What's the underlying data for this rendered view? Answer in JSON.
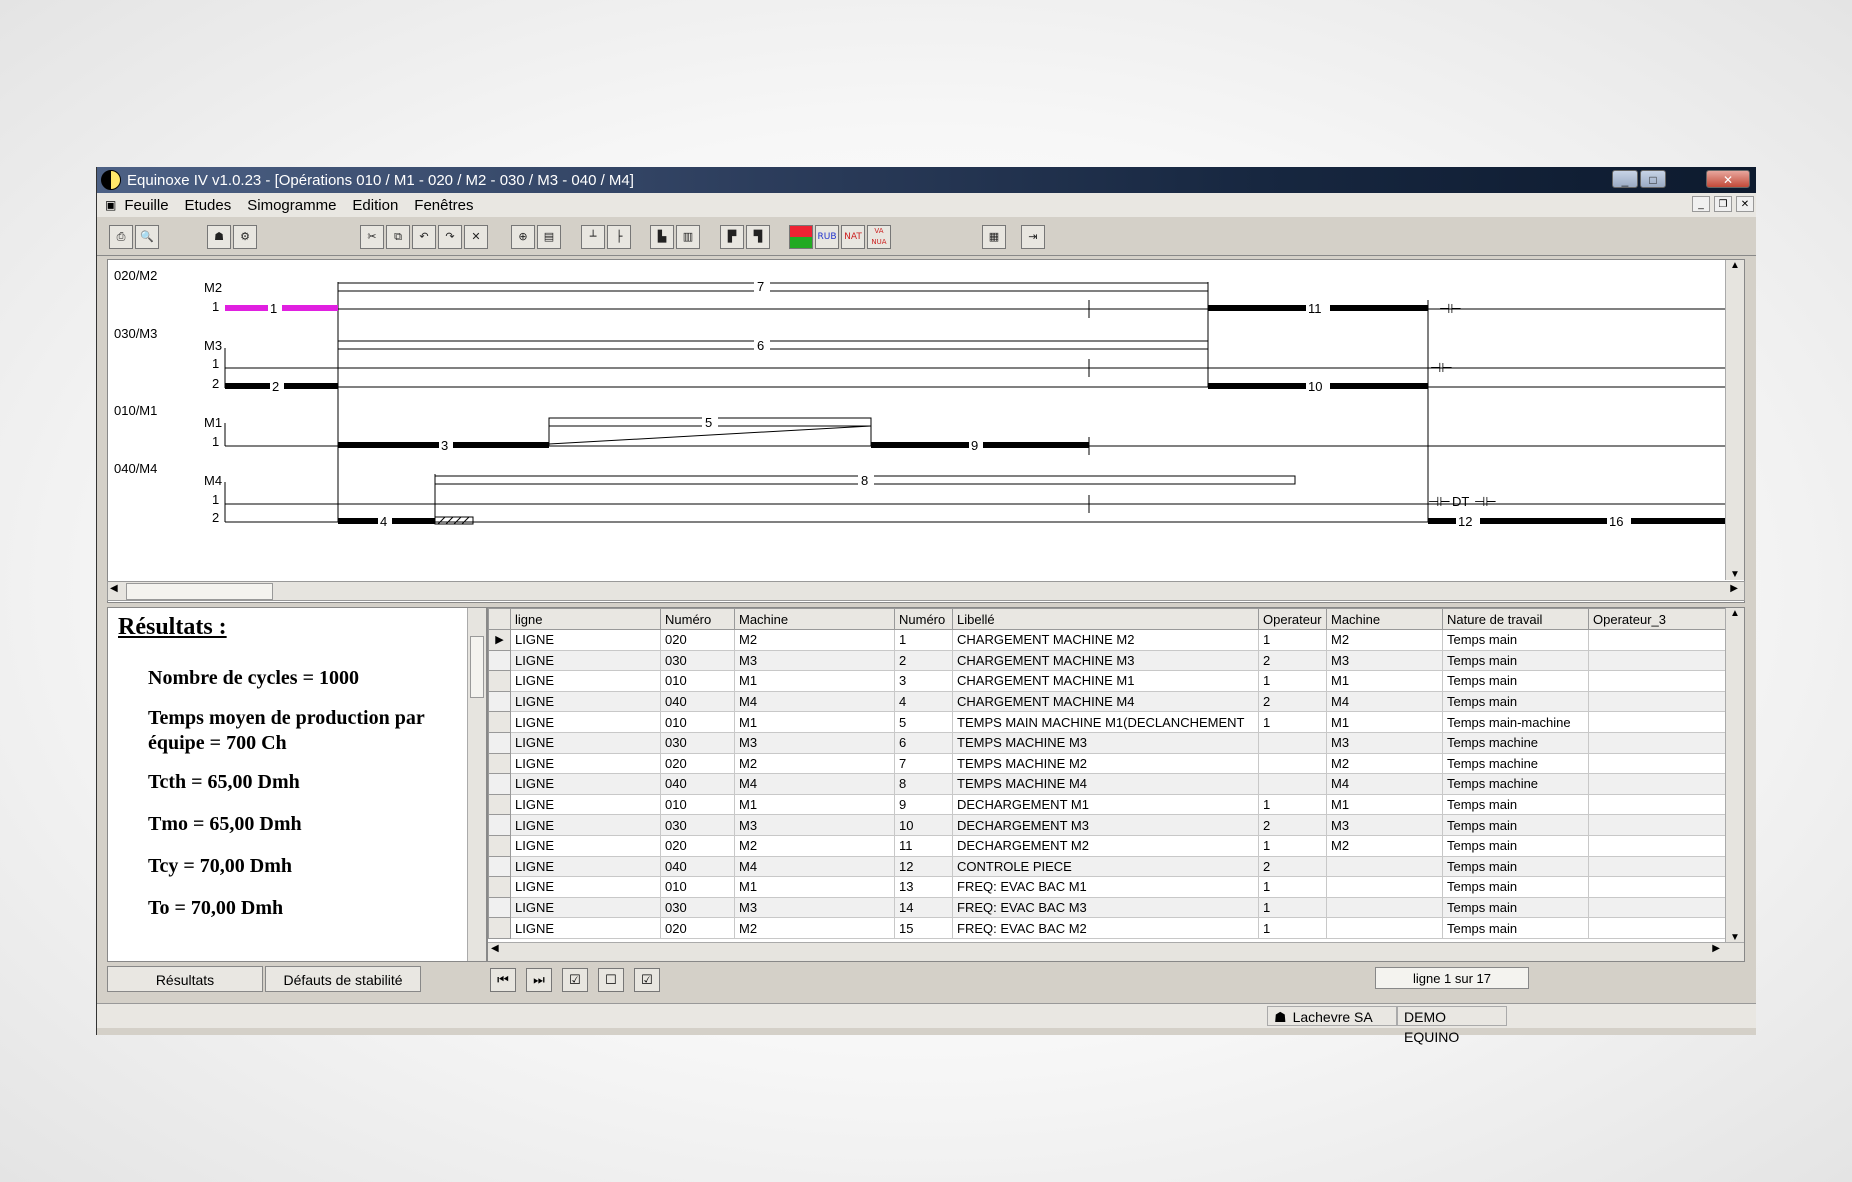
{
  "window": {
    "title": "Equinoxe IV v1.0.23 - [Opérations 010 / M1  -  020 / M2  -  030 / M3  -  040 / M4]",
    "controls": {
      "minimize": "_",
      "maximize": "□",
      "close": "✕"
    }
  },
  "menu": {
    "items": [
      "Feuille",
      "Etudes",
      "Simogramme",
      "Edition",
      "Fenêtres"
    ]
  },
  "toolbar": {
    "icons": [
      "print-icon",
      "print-preview-icon",
      "operator-icon",
      "operator-settings-icon",
      "cut-icon",
      "copy-icon",
      "undo-icon",
      "redo-icon",
      "delete-icon",
      "add-operation-icon",
      "properties-icon",
      "ruler-h-icon",
      "ruler-v-icon",
      "bar-view-icon",
      "multi-bar-view-icon",
      "split-view-icon",
      "merge-view-icon",
      "color-icon",
      "rub-icon",
      "nat-icon",
      "nua-icon",
      "grid-icon",
      "exit-icon"
    ],
    "labels": {
      "rub": "RUB",
      "nat": "NAT",
      "nua": "VA NUA"
    }
  },
  "gantt": {
    "groups": [
      {
        "name": "020/M2",
        "rows": [
          "M2",
          "1"
        ]
      },
      {
        "name": "030/M3",
        "rows": [
          "M3",
          "1",
          "2"
        ]
      },
      {
        "name": "010/M1",
        "rows": [
          "M1",
          "1"
        ]
      },
      {
        "name": "040/M4",
        "rows": [
          "M4",
          "1",
          "2"
        ]
      }
    ],
    "labels": [
      "1",
      "7",
      "11",
      "6",
      "2",
      "10",
      "5",
      "3",
      "9",
      "8",
      "4",
      "12",
      "16",
      "DT"
    ],
    "colors": {
      "highlight": "#e020e0",
      "bar": "#000000"
    }
  },
  "results": {
    "title": "Résultats :",
    "lines": [
      "Nombre de cycles = 1000",
      "Temps moyen de production par équipe = 700 Ch",
      "Tcth = 65,00 Dmh",
      "Tmo = 65,00 Dmh",
      "Tcy = 70,00 Dmh",
      "To = 70,00 Dmh"
    ],
    "tabs": [
      "Résultats",
      "Défauts de stabilité"
    ]
  },
  "table": {
    "columns": [
      "ligne",
      "Numéro",
      "Machine",
      "Numéro",
      "Libellé",
      "Operateur",
      "Machine",
      "Nature de travail",
      "Operateur_3"
    ],
    "rows": [
      [
        "LIGNE",
        "020",
        "M2",
        "1",
        "CHARGEMENT MACHINE M2",
        "1",
        "M2",
        "Temps main",
        ""
      ],
      [
        "LIGNE",
        "030",
        "M3",
        "2",
        "CHARGEMENT MACHINE M3",
        "2",
        "M3",
        "Temps main",
        ""
      ],
      [
        "LIGNE",
        "010",
        "M1",
        "3",
        "CHARGEMENT MACHINE M1",
        "1",
        "M1",
        "Temps main",
        ""
      ],
      [
        "LIGNE",
        "040",
        "M4",
        "4",
        "CHARGEMENT MACHINE M4",
        "2",
        "M4",
        "Temps main",
        ""
      ],
      [
        "LIGNE",
        "010",
        "M1",
        "5",
        "TEMPS MAIN MACHINE M1(DECLANCHEMENT",
        "1",
        "M1",
        "Temps main-machine",
        ""
      ],
      [
        "LIGNE",
        "030",
        "M3",
        "6",
        "TEMPS MACHINE M3",
        "",
        "M3",
        "Temps machine",
        ""
      ],
      [
        "LIGNE",
        "020",
        "M2",
        "7",
        "TEMPS MACHINE M2",
        "",
        "M2",
        "Temps machine",
        ""
      ],
      [
        "LIGNE",
        "040",
        "M4",
        "8",
        "TEMPS MACHINE M4",
        "",
        "M4",
        "Temps machine",
        ""
      ],
      [
        "LIGNE",
        "010",
        "M1",
        "9",
        "DECHARGEMENT M1",
        "1",
        "M1",
        "Temps main",
        ""
      ],
      [
        "LIGNE",
        "030",
        "M3",
        "10",
        "DECHARGEMENT M3",
        "2",
        "M3",
        "Temps main",
        ""
      ],
      [
        "LIGNE",
        "020",
        "M2",
        "11",
        "DECHARGEMENT M2",
        "1",
        "M2",
        "Temps main",
        ""
      ],
      [
        "LIGNE",
        "040",
        "M4",
        "12",
        "CONTROLE PIECE",
        "2",
        "",
        "Temps main",
        ""
      ],
      [
        "LIGNE",
        "010",
        "M1",
        "13",
        "FREQ: EVAC BAC M1",
        "1",
        "",
        "Temps main",
        ""
      ],
      [
        "LIGNE",
        "030",
        "M3",
        "14",
        "FREQ: EVAC BAC  M3",
        "1",
        "",
        "Temps main",
        ""
      ],
      [
        "LIGNE",
        "020",
        "M2",
        "15",
        "FREQ: EVAC BAC  M2",
        "1",
        "",
        "Temps main",
        ""
      ]
    ]
  },
  "pager": {
    "text": "ligne 1 sur 17"
  },
  "status": {
    "company": "Lachevre SA",
    "user": "DEMO EQUINO"
  }
}
